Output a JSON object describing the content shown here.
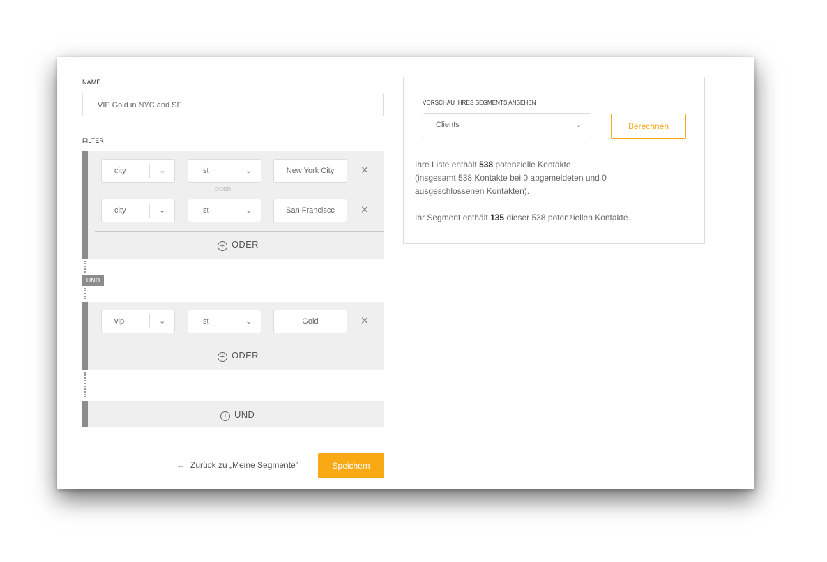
{
  "form": {
    "name_label": "NAME",
    "name_value": "VIP Gold in NYC and SF",
    "filter_label": "FILTER"
  },
  "groups": [
    {
      "conditions": [
        {
          "field": "city",
          "operator": "Ist",
          "value": "New York City"
        },
        {
          "field": "city",
          "operator": "Ist",
          "value": "San Franciscc"
        }
      ],
      "or_separator": "ODER",
      "add_or_label": "ODER"
    },
    {
      "conditions": [
        {
          "field": "vip",
          "operator": "Ist",
          "value": "Gold"
        }
      ],
      "add_or_label": "ODER"
    }
  ],
  "and_tag": "UND",
  "add_and_label": "UND",
  "footer": {
    "back_label": "Zurück zu „Meine Segmente\"",
    "save_label": "Speichern"
  },
  "preview": {
    "label": "VORSCHAU IHRES SEGMENTS ANSEHEN",
    "selected_list": "Clients",
    "calculate_label": "Berechnen",
    "line1_pre": "Ihre Liste enthält ",
    "line1_count": "538",
    "line1_post": " potenzielle Kontakte",
    "line2": "(insgesamt 538 Kontakte bei 0 abgemeldeten und 0",
    "line3": "ausgeschlossenen Kontakten).",
    "segment_pre": "Ihr Segment enthält ",
    "segment_count": "135",
    "segment_post": " dieser 538 potenziellen Kontakte."
  },
  "icons": {
    "chevron": "chevron-down-icon",
    "close": "close-icon",
    "plus": "plus-circle-icon",
    "back": "arrow-left-icon"
  },
  "colors": {
    "accent": "#f9a913",
    "group_bg": "#efefef",
    "group_bar": "#8c8c8c"
  }
}
